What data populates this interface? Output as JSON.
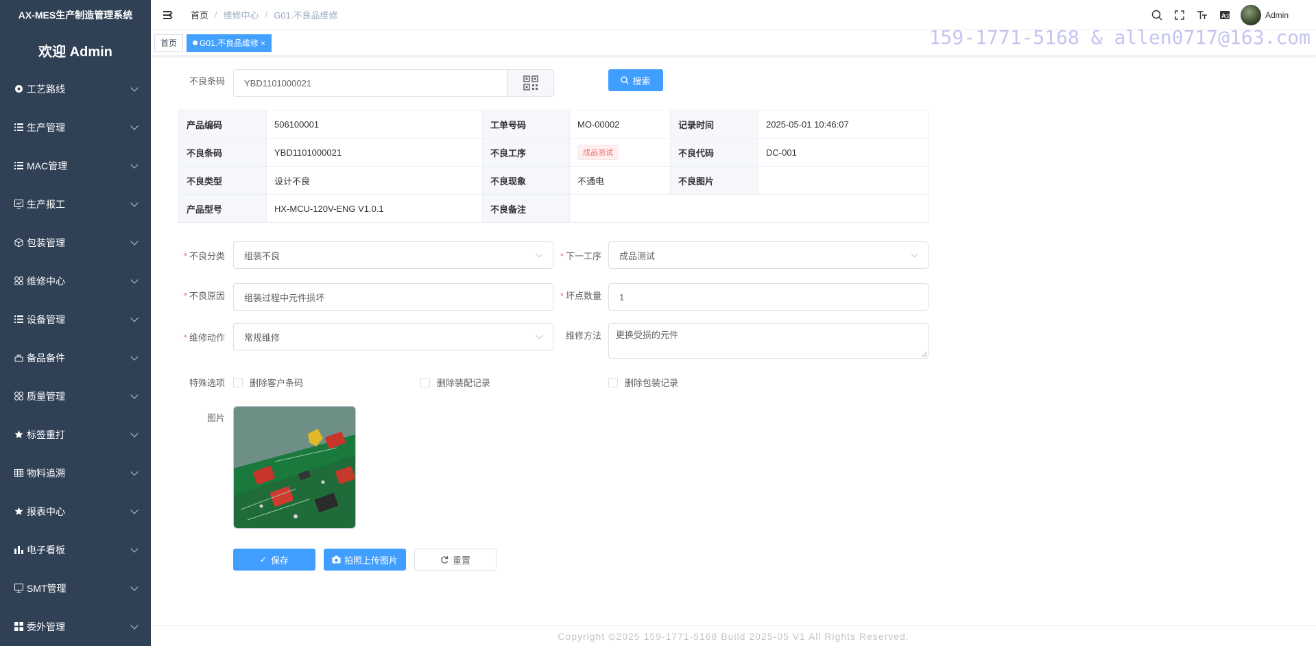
{
  "app": {
    "title": "AX-MES生产制造管理系统",
    "welcome": "欢迎 Admin"
  },
  "sidebar": {
    "items": [
      {
        "label": "工艺路线",
        "icon": "route-icon"
      },
      {
        "label": "生产管理",
        "icon": "list-icon"
      },
      {
        "label": "MAC管理",
        "icon": "list-icon"
      },
      {
        "label": "生产报工",
        "icon": "report-icon"
      },
      {
        "label": "包装管理",
        "icon": "box-icon"
      },
      {
        "label": "维修中心",
        "icon": "grid-icon"
      },
      {
        "label": "设备管理",
        "icon": "list-icon"
      },
      {
        "label": "备品备件",
        "icon": "parts-icon"
      },
      {
        "label": "质量管理",
        "icon": "grid-icon"
      },
      {
        "label": "标签重打",
        "icon": "star-icon"
      },
      {
        "label": "物料追溯",
        "icon": "table-icon"
      },
      {
        "label": "报表中心",
        "icon": "star-icon"
      },
      {
        "label": "电子看板",
        "icon": "bar-chart-icon"
      },
      {
        "label": "SMT管理",
        "icon": "monitor-icon"
      },
      {
        "label": "委外管理",
        "icon": "apps-icon"
      }
    ]
  },
  "breadcrumb": {
    "home": "首页",
    "level1": "维修中心",
    "level2": "G01.不良品维修"
  },
  "user": {
    "name": "Admin"
  },
  "tags": {
    "home": "首页",
    "active": "G01.不良品维修",
    "close": "×"
  },
  "watermark": "159-1771-5168 & allen0717@163.com",
  "search": {
    "label": "不良条码",
    "value": "YBD1101000021",
    "button": "搜索"
  },
  "info": {
    "product_code_label": "产品编码",
    "product_code": "506100001",
    "work_order_label": "工单号码",
    "work_order": "MO-00002",
    "record_time_label": "记录时间",
    "record_time": "2025-05-01 10:46:07",
    "defect_barcode_label": "不良条码",
    "defect_barcode": "YBD1101000021",
    "defect_process_label": "不良工序",
    "defect_process": "成品测试",
    "defect_code_label": "不良代码",
    "defect_code": "DC-001",
    "defect_type_label": "不良类型",
    "defect_type": "设计不良",
    "defect_symptom_label": "不良现象",
    "defect_symptom": "不通电",
    "defect_image_label": "不良图片",
    "product_model_label": "产品型号",
    "product_model": "HX-MCU-120V-ENG V1.0.1",
    "defect_remark_label": "不良备注",
    "defect_remark": ""
  },
  "form": {
    "category_label": "不良分类",
    "category": "组装不良",
    "next_process_label": "下一工序",
    "next_process": "成品测试",
    "reason_label": "不良原因",
    "reason": "组装过程中元件损坏",
    "bad_points_label": "坏点数量",
    "bad_points": "1",
    "action_label": "维修动作",
    "action": "常规维修",
    "method_label": "维修方法",
    "method": "更换受损的元件",
    "options_label": "特殊选项",
    "opt1": "删除客户条码",
    "opt2": "删除装配记录",
    "opt3": "删除包装记录",
    "image_label": "图片"
  },
  "buttons": {
    "save": "保存",
    "upload": "拍照上传图片",
    "reset": "重置"
  },
  "footer": "Copyright ©2025 159-1771-5168 Build 2025-05 V1 All Rights Reserved.",
  "colors": {
    "sidebar": "#304156",
    "primary": "#409eff",
    "danger": "#f56c6c"
  }
}
